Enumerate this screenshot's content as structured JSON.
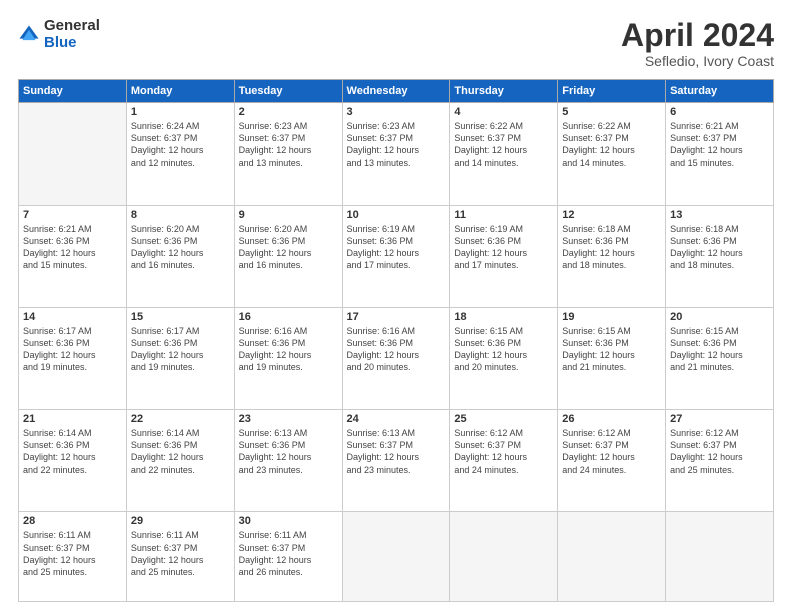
{
  "logo": {
    "general": "General",
    "blue": "Blue"
  },
  "title": "April 2024",
  "location": "Sefledio, Ivory Coast",
  "headers": [
    "Sunday",
    "Monday",
    "Tuesday",
    "Wednesday",
    "Thursday",
    "Friday",
    "Saturday"
  ],
  "weeks": [
    [
      {
        "day": "",
        "info": ""
      },
      {
        "day": "1",
        "info": "Sunrise: 6:24 AM\nSunset: 6:37 PM\nDaylight: 12 hours\nand 12 minutes."
      },
      {
        "day": "2",
        "info": "Sunrise: 6:23 AM\nSunset: 6:37 PM\nDaylight: 12 hours\nand 13 minutes."
      },
      {
        "day": "3",
        "info": "Sunrise: 6:23 AM\nSunset: 6:37 PM\nDaylight: 12 hours\nand 13 minutes."
      },
      {
        "day": "4",
        "info": "Sunrise: 6:22 AM\nSunset: 6:37 PM\nDaylight: 12 hours\nand 14 minutes."
      },
      {
        "day": "5",
        "info": "Sunrise: 6:22 AM\nSunset: 6:37 PM\nDaylight: 12 hours\nand 14 minutes."
      },
      {
        "day": "6",
        "info": "Sunrise: 6:21 AM\nSunset: 6:37 PM\nDaylight: 12 hours\nand 15 minutes."
      }
    ],
    [
      {
        "day": "7",
        "info": "Sunrise: 6:21 AM\nSunset: 6:36 PM\nDaylight: 12 hours\nand 15 minutes."
      },
      {
        "day": "8",
        "info": "Sunrise: 6:20 AM\nSunset: 6:36 PM\nDaylight: 12 hours\nand 16 minutes."
      },
      {
        "day": "9",
        "info": "Sunrise: 6:20 AM\nSunset: 6:36 PM\nDaylight: 12 hours\nand 16 minutes."
      },
      {
        "day": "10",
        "info": "Sunrise: 6:19 AM\nSunset: 6:36 PM\nDaylight: 12 hours\nand 17 minutes."
      },
      {
        "day": "11",
        "info": "Sunrise: 6:19 AM\nSunset: 6:36 PM\nDaylight: 12 hours\nand 17 minutes."
      },
      {
        "day": "12",
        "info": "Sunrise: 6:18 AM\nSunset: 6:36 PM\nDaylight: 12 hours\nand 18 minutes."
      },
      {
        "day": "13",
        "info": "Sunrise: 6:18 AM\nSunset: 6:36 PM\nDaylight: 12 hours\nand 18 minutes."
      }
    ],
    [
      {
        "day": "14",
        "info": "Sunrise: 6:17 AM\nSunset: 6:36 PM\nDaylight: 12 hours\nand 19 minutes."
      },
      {
        "day": "15",
        "info": "Sunrise: 6:17 AM\nSunset: 6:36 PM\nDaylight: 12 hours\nand 19 minutes."
      },
      {
        "day": "16",
        "info": "Sunrise: 6:16 AM\nSunset: 6:36 PM\nDaylight: 12 hours\nand 19 minutes."
      },
      {
        "day": "17",
        "info": "Sunrise: 6:16 AM\nSunset: 6:36 PM\nDaylight: 12 hours\nand 20 minutes."
      },
      {
        "day": "18",
        "info": "Sunrise: 6:15 AM\nSunset: 6:36 PM\nDaylight: 12 hours\nand 20 minutes."
      },
      {
        "day": "19",
        "info": "Sunrise: 6:15 AM\nSunset: 6:36 PM\nDaylight: 12 hours\nand 21 minutes."
      },
      {
        "day": "20",
        "info": "Sunrise: 6:15 AM\nSunset: 6:36 PM\nDaylight: 12 hours\nand 21 minutes."
      }
    ],
    [
      {
        "day": "21",
        "info": "Sunrise: 6:14 AM\nSunset: 6:36 PM\nDaylight: 12 hours\nand 22 minutes."
      },
      {
        "day": "22",
        "info": "Sunrise: 6:14 AM\nSunset: 6:36 PM\nDaylight: 12 hours\nand 22 minutes."
      },
      {
        "day": "23",
        "info": "Sunrise: 6:13 AM\nSunset: 6:36 PM\nDaylight: 12 hours\nand 23 minutes."
      },
      {
        "day": "24",
        "info": "Sunrise: 6:13 AM\nSunset: 6:37 PM\nDaylight: 12 hours\nand 23 minutes."
      },
      {
        "day": "25",
        "info": "Sunrise: 6:12 AM\nSunset: 6:37 PM\nDaylight: 12 hours\nand 24 minutes."
      },
      {
        "day": "26",
        "info": "Sunrise: 6:12 AM\nSunset: 6:37 PM\nDaylight: 12 hours\nand 24 minutes."
      },
      {
        "day": "27",
        "info": "Sunrise: 6:12 AM\nSunset: 6:37 PM\nDaylight: 12 hours\nand 25 minutes."
      }
    ],
    [
      {
        "day": "28",
        "info": "Sunrise: 6:11 AM\nSunset: 6:37 PM\nDaylight: 12 hours\nand 25 minutes."
      },
      {
        "day": "29",
        "info": "Sunrise: 6:11 AM\nSunset: 6:37 PM\nDaylight: 12 hours\nand 25 minutes."
      },
      {
        "day": "30",
        "info": "Sunrise: 6:11 AM\nSunset: 6:37 PM\nDaylight: 12 hours\nand 26 minutes."
      },
      {
        "day": "",
        "info": ""
      },
      {
        "day": "",
        "info": ""
      },
      {
        "day": "",
        "info": ""
      },
      {
        "day": "",
        "info": ""
      }
    ]
  ]
}
